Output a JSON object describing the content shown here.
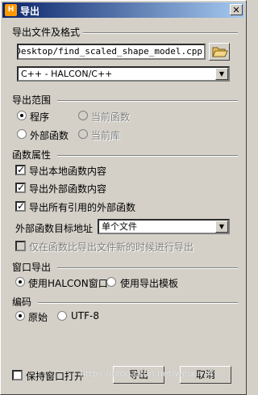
{
  "window": {
    "title": "导出",
    "app_icon": "HALCON-logo-icon",
    "close_label": "✕"
  },
  "export_file": {
    "section_title": "导出文件及格式",
    "path_value": "or/Desktop/find_scaled_shape_model.cpp",
    "format_value": "C++ - HALCON/C++"
  },
  "export_scope": {
    "section_title": "导出范围",
    "options": [
      {
        "label": "程序",
        "selected": true,
        "enabled": true
      },
      {
        "label": "当前函数",
        "selected": false,
        "enabled": false
      },
      {
        "label": "外部函数",
        "selected": false,
        "enabled": true
      },
      {
        "label": "当前库",
        "selected": false,
        "enabled": false
      }
    ]
  },
  "function_props": {
    "section_title": "函数属性",
    "checks": [
      {
        "label": "导出本地函数内容",
        "checked": true
      },
      {
        "label": "导出外部函数内容",
        "checked": true
      },
      {
        "label": "导出所有引用的外部函数",
        "checked": true
      }
    ],
    "target_label": "外部函数目标地址",
    "target_value": "单个文件",
    "newer_label": "仅在函数比导出文件新的时候进行导出"
  },
  "window_export": {
    "section_title": "窗口导出",
    "options": [
      {
        "label": "使用HALCON窗口",
        "selected": true,
        "enabled": true
      },
      {
        "label": "使用导出模板",
        "selected": false,
        "enabled": true
      }
    ]
  },
  "encoding": {
    "section_title": "编码",
    "options": [
      {
        "label": "原始",
        "selected": true
      },
      {
        "label": "UTF-8",
        "selected": false
      }
    ]
  },
  "footer": {
    "keep_open_label": "保持窗口打开",
    "export_label": "导出",
    "cancel_label": "取消",
    "watermark": "https://blog.csdn.net/weixin_4…"
  }
}
